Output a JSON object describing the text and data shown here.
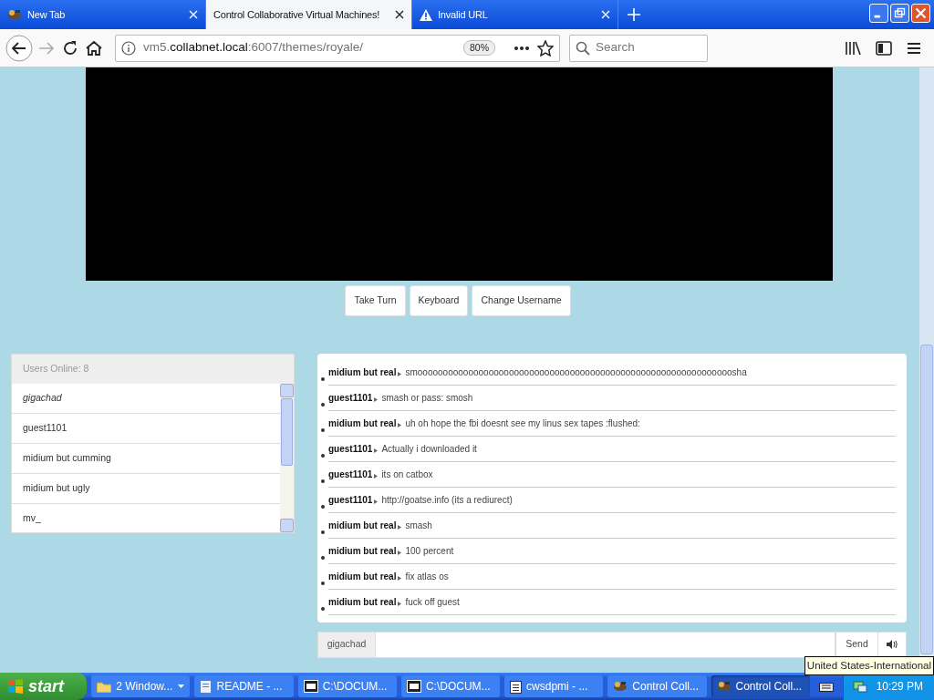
{
  "browser": {
    "tabs": [
      {
        "label": "New Tab",
        "selected": false,
        "kind": "app"
      },
      {
        "label": "Control Collaborative Virtual Machines!",
        "selected": true,
        "kind": "plain"
      },
      {
        "label": "Invalid URL",
        "selected": false,
        "kind": "warning"
      }
    ],
    "url": {
      "prefix": "vm5.",
      "domain": "collabnet.local",
      "suffix": ":6007/themes/royale/"
    },
    "zoom": "80%",
    "search": {
      "placeholder": "Search"
    }
  },
  "controls": [
    "Take Turn",
    "Keyboard",
    "Change Username"
  ],
  "users": {
    "header": "Users Online: 8",
    "items": [
      {
        "name": "gigachad",
        "self": true
      },
      {
        "name": "guest1101",
        "self": false
      },
      {
        "name": "midium but cumming",
        "self": false
      },
      {
        "name": "midium but ugly",
        "self": false
      },
      {
        "name": "mv_",
        "self": false
      }
    ]
  },
  "messages": [
    {
      "user": "midium but real",
      "text": "smoooooooooooooooooooooooooooooooooooooooooooooooooooooooooooooosha"
    },
    {
      "user": "guest1101",
      "text": "smash or pass: smosh"
    },
    {
      "user": "midium but real",
      "text": "uh oh hope the fbi doesnt see my linus sex tapes :flushed:"
    },
    {
      "user": "guest1101",
      "text": "Actually i downloaded it"
    },
    {
      "user": "guest1101",
      "text": "its on catbox"
    },
    {
      "user": "guest1101",
      "text": "http://goatse.info (its a rediurect)"
    },
    {
      "user": "midium but real",
      "text": "smash"
    },
    {
      "user": "midium but real",
      "text": "100 percent"
    },
    {
      "user": "midium but real",
      "text": "fix atlas os"
    },
    {
      "user": "midium but real",
      "text": "fuck off guest"
    }
  ],
  "chat_input": {
    "username": "gigachad",
    "send": "Send"
  },
  "tooltip": "United States-International",
  "taskbar": {
    "start": "start",
    "tasks": [
      {
        "label": "2 Window...",
        "kind": "folder",
        "grouped": true,
        "selected": false
      },
      {
        "label": "README - ...",
        "kind": "document",
        "grouped": false,
        "selected": false
      },
      {
        "label": "C:\\DOCUM...",
        "kind": "archive",
        "grouped": false,
        "selected": false
      },
      {
        "label": "C:\\DOCUM...",
        "kind": "archive",
        "grouped": false,
        "selected": false
      },
      {
        "label": "cwsdpmi - ...",
        "kind": "notepad",
        "grouped": false,
        "selected": false
      },
      {
        "label": "Control Coll...",
        "kind": "app",
        "grouped": false,
        "selected": false
      },
      {
        "label": "Control Coll...",
        "kind": "app",
        "grouped": false,
        "selected": true
      }
    ],
    "clock": "10:29 PM"
  }
}
